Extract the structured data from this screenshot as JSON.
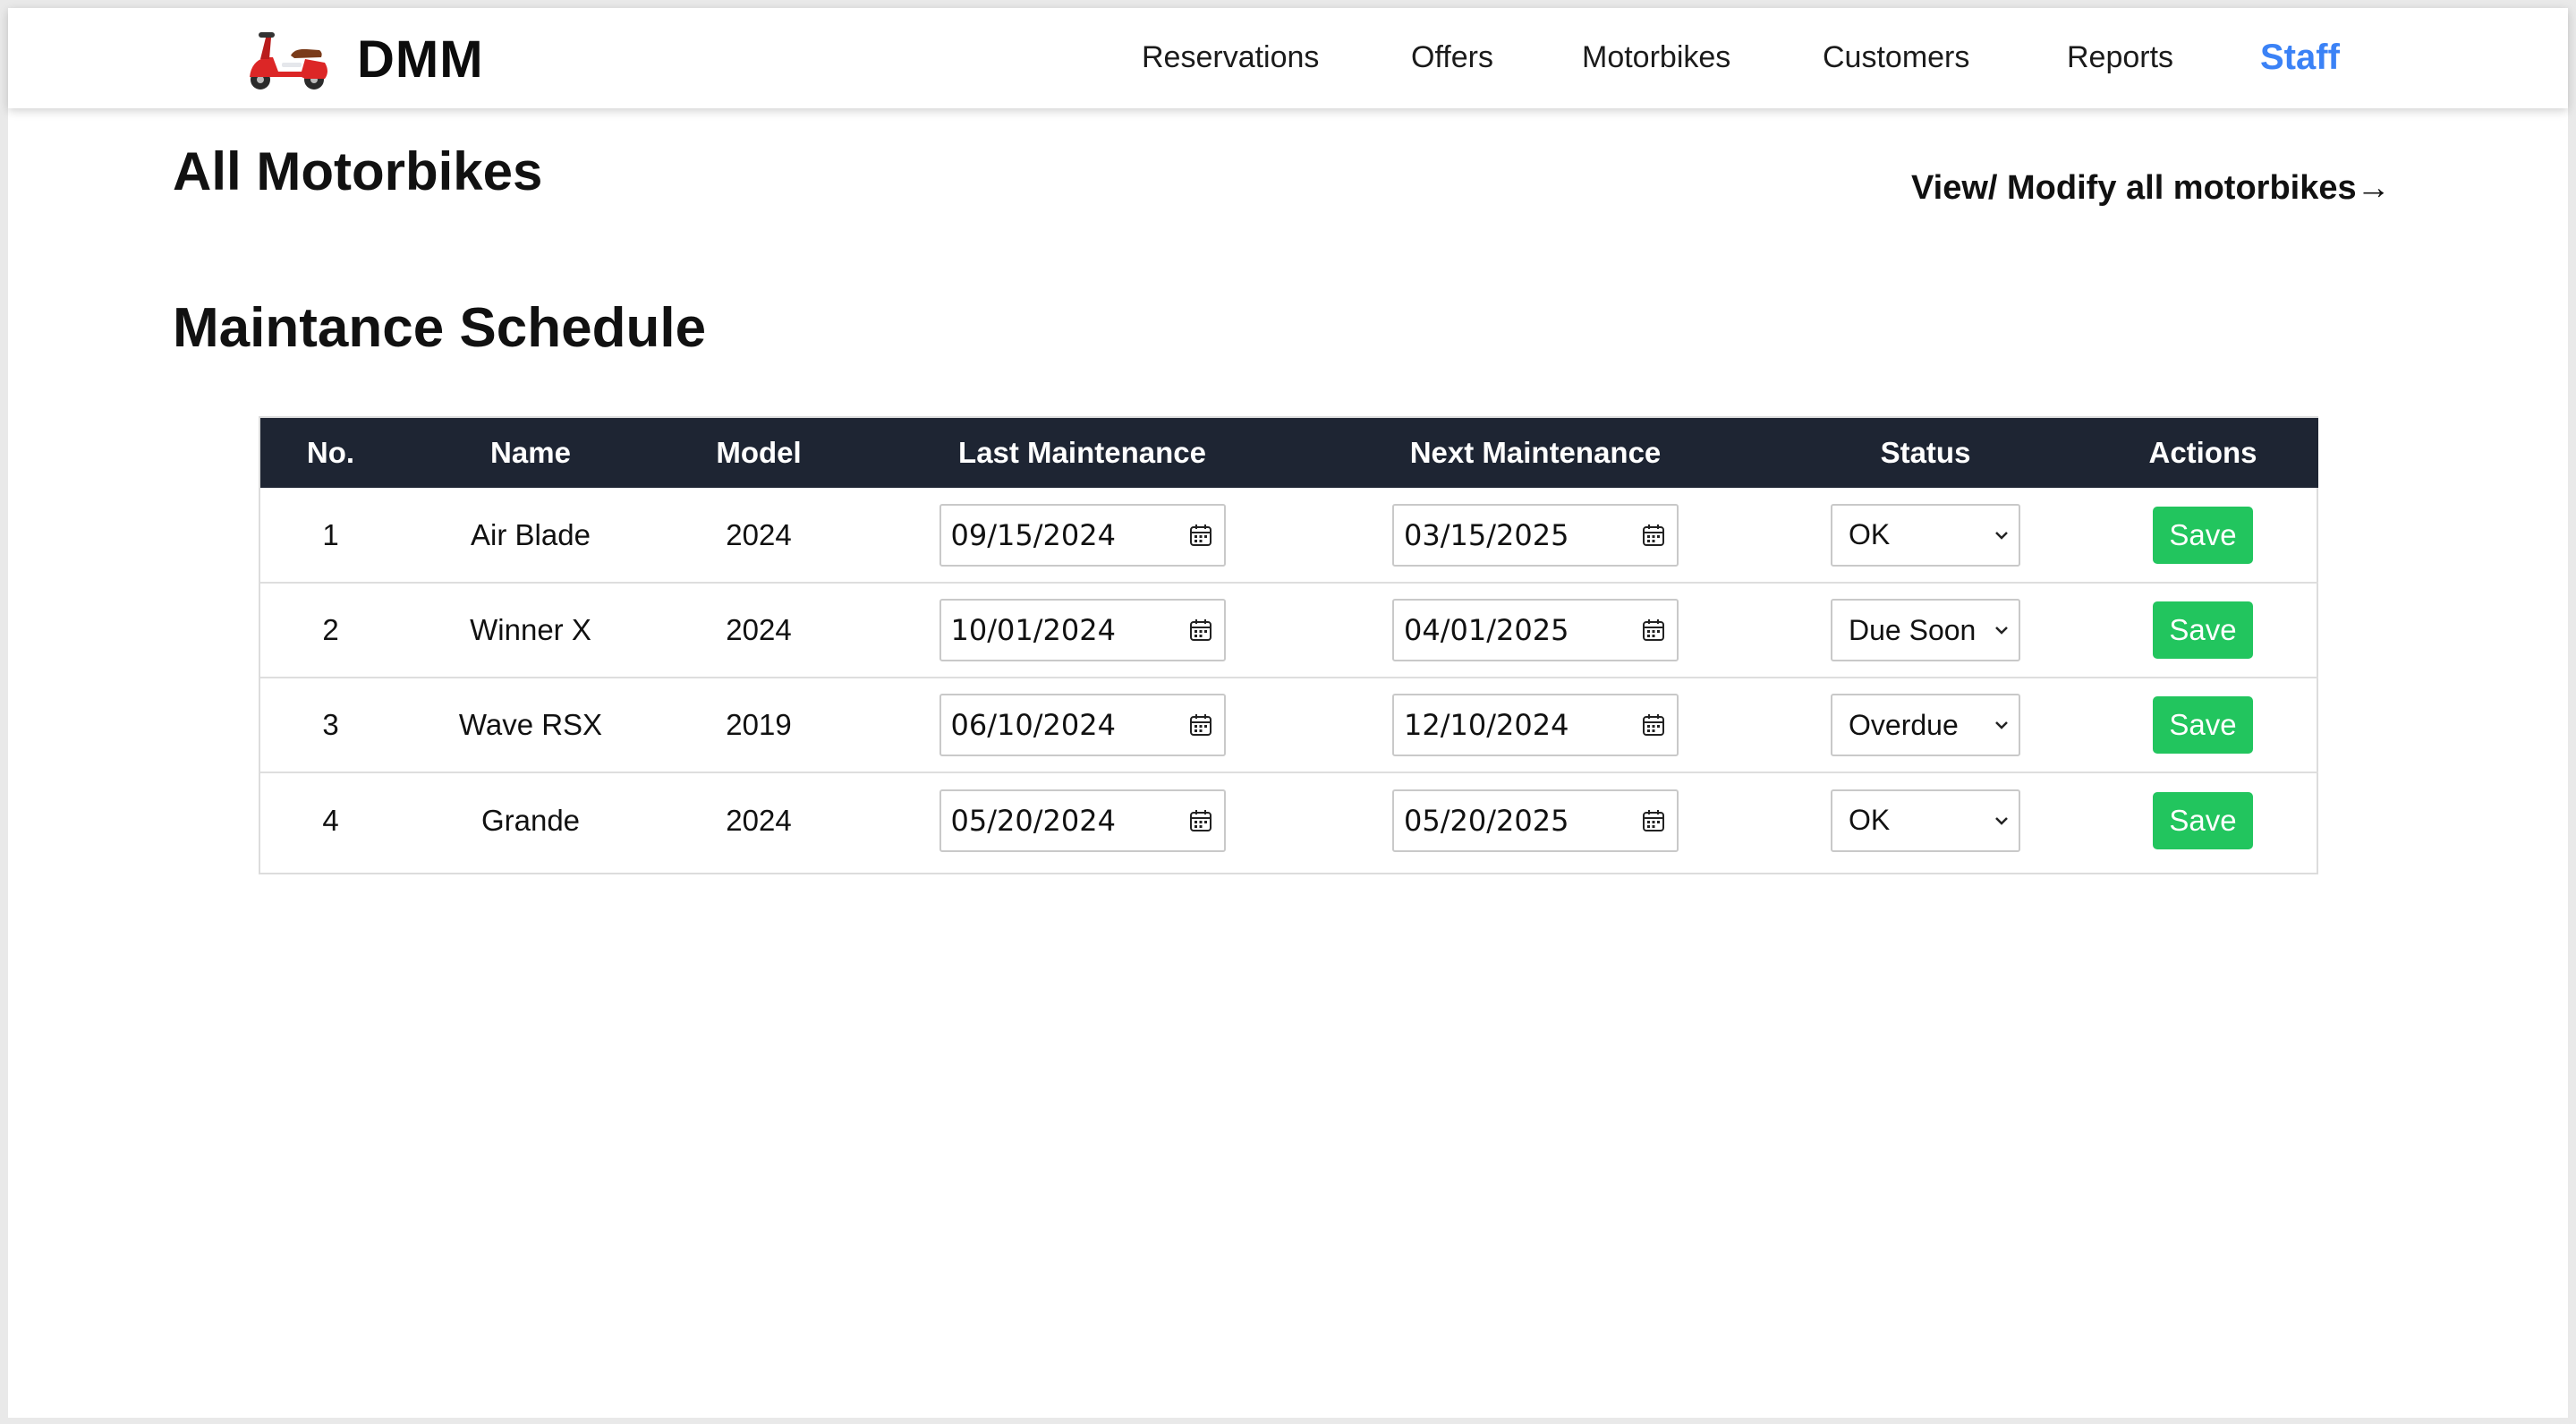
{
  "header": {
    "brand": "DMM",
    "nav": [
      "Reservations",
      "Offers",
      "Motorbikes",
      "Customers",
      "Reports",
      "Staff"
    ],
    "active_nav": "Staff"
  },
  "page": {
    "title": "All Motorbikes",
    "view_link": "View/ Modify all motorbikes→",
    "section_title": "Maintance Schedule"
  },
  "table": {
    "headers": [
      "No.",
      "Name",
      "Model",
      "Last Maintenance",
      "Next Maintenance",
      "Status",
      "Actions"
    ],
    "rows": [
      {
        "no": "1",
        "name": "Air Blade",
        "model": "2024",
        "last": "09/15/2024",
        "next": "03/15/2025",
        "status": "OK",
        "action": "Save"
      },
      {
        "no": "2",
        "name": "Winner X",
        "model": "2024",
        "last": "10/01/2024",
        "next": "04/01/2025",
        "status": "Due Soon",
        "action": "Save"
      },
      {
        "no": "3",
        "name": "Wave RSX",
        "model": "2019",
        "last": "06/10/2024",
        "next": "12/10/2024",
        "status": "Overdue",
        "action": "Save"
      },
      {
        "no": "4",
        "name": "Grande",
        "model": "2024",
        "last": "05/20/2024",
        "next": "05/20/2025",
        "status": "OK",
        "action": "Save"
      }
    ]
  },
  "colors": {
    "table_header": "#1e2533",
    "save_button": "#22c55e",
    "active_nav": "#3b82f6"
  }
}
